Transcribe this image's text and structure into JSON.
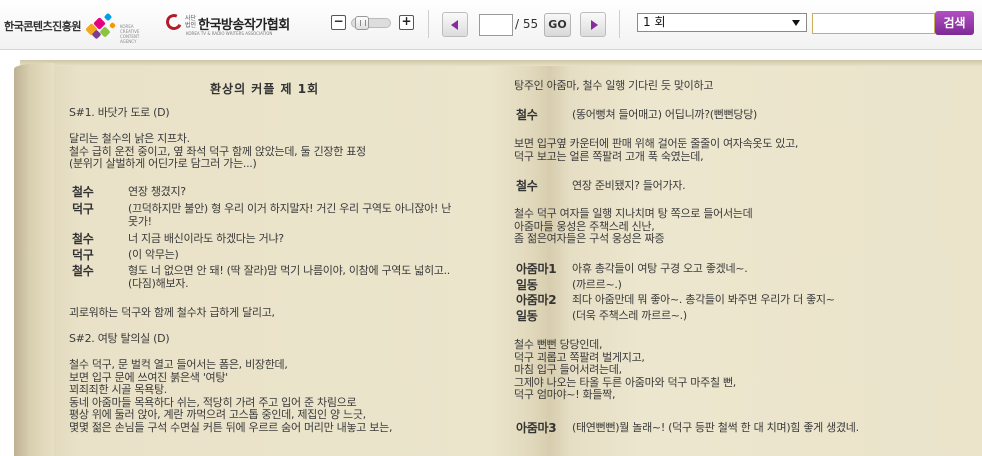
{
  "toolbar": {
    "logo1_text": "한국콘텐츠진흥원",
    "logo1_sub": "KOREA CREATIVE CONTENT AGENCY",
    "logo2_mini": "사단법인",
    "logo2_name": "한국방송작가협회",
    "logo2_eng": "KOREA TV & RADIO WRITERS ASSOCIATION",
    "zoom_out": "−",
    "zoom_in": "+",
    "page_value": "",
    "page_total": "/ 55",
    "go_label": "GO",
    "episode_selected": "1 회",
    "search_value": "",
    "search_label": "검색"
  },
  "script": {
    "title": "환상의 커플 제 1회",
    "left": {
      "scene1": "S#1. 바닷가 도로 (D)",
      "desc1": [
        "달리는 철수의 낡은 지프차.",
        "철수 급히 운전 중이고, 옆 좌석 덕구 함께 앉았는데, 둘 긴장한 표정",
        "(분위기 살벌하게 어딘가로 담그러 가는...)"
      ],
      "dialogue": [
        {
          "speaker": "철수",
          "text": "연장 챙겼지?"
        },
        {
          "speaker": "덕구",
          "text": "(끄덕하지만 불안) 형 우리 이거 하지말자! 거긴 우리 구역도 아니잖아! 난\n못가!"
        },
        {
          "speaker": "철수",
          "text": "너 지금 배신이라도 하겠다는 거냐?"
        },
        {
          "speaker": "덕구",
          "text": "(이 악무는)"
        },
        {
          "speaker": "철수",
          "text": "형도 너 없으면 안 돼! (딱 잘라)맘 먹기 나름이야, 이참에 구역도 넓히고..\n(다짐)해보자."
        }
      ],
      "desc2": "괴로워하는 덕구와 함께 철수차 급하게 달리고,",
      "scene2": "S#2. 여탕 탈의실 (D)",
      "desc3": [
        "철수 덕구, 문 벌컥 열고 들어서는 폼은, 비장한데,",
        "보면 입구 문에 쓰여진 붉은색 '여탕'",
        "꾀죄죄한 시골 목욕탕.",
        "동네 아줌마들 목욕하다 쉬는, 적당히 가려 주고 입어 준 차림으로",
        "평상 위에 둘러 앉아, 계란 까먹으려 고스톱 중인데, 제집인 양 느긋,",
        "몇몇 젊은 손님들 구석 수면실 커튼 뒤에 우르르 숨어 머리만 내놓고 보는,"
      ]
    },
    "right": {
      "desc0": "탕주인 아줌마, 철수 일행 기다린 듯 맞이하고",
      "d1": {
        "speaker": "철수",
        "text": "(똥어뻥쳐 들어매고) 어딥니까?(뻔뻔당당)"
      },
      "desc1": [
        "보면 입구옆 카운터에 판매 위해 걸어둔 줄줄이 여자속옷도 있고,",
        "덕구 보고는 얼른 쪽팔려 고개 푹 숙였는데,"
      ],
      "d2": {
        "speaker": "철수",
        "text": "연장 준비됐지? 들어가자."
      },
      "desc2": [
        "철수 덕구 여자들 일행 지나치며 탕 쪽으로 들어서는데",
        "아줌마들 웅성은 주책스레 신난,",
        "좀 젊은여자들은 구석 웅성은 짜증"
      ],
      "dialogue2": [
        {
          "speaker": "아줌마1",
          "text": "아휴 총각들이 여탕 구경 오고 좋겠네~."
        },
        {
          "speaker": "일동",
          "text": "(까르르~.)"
        },
        {
          "speaker": "아줌마2",
          "text": "죄다 아줌만데 뭐 좋아~. 총각들이 봐주면 우리가 더 좋지~"
        },
        {
          "speaker": "일동",
          "text": "(더욱 주책스레 까르르~.)"
        }
      ],
      "desc3": [
        "철수 뻔뻔 당당인데,",
        "덕구 괴롭고 쪽팔려 벌게지고,",
        "마침 입구 들어서려는데,",
        "그제야 나오는 타올 두른 아줌마와 덕구 마주칠 뻔,",
        "덕구 엄마야~! 화들짝,"
      ],
      "d3": {
        "speaker": "아줌마3",
        "text": "(태연뻔뻔)뭘 놀래~! (덕구 등판 철썩 한 대 치며)힘 좋게 생겼네."
      }
    }
  }
}
